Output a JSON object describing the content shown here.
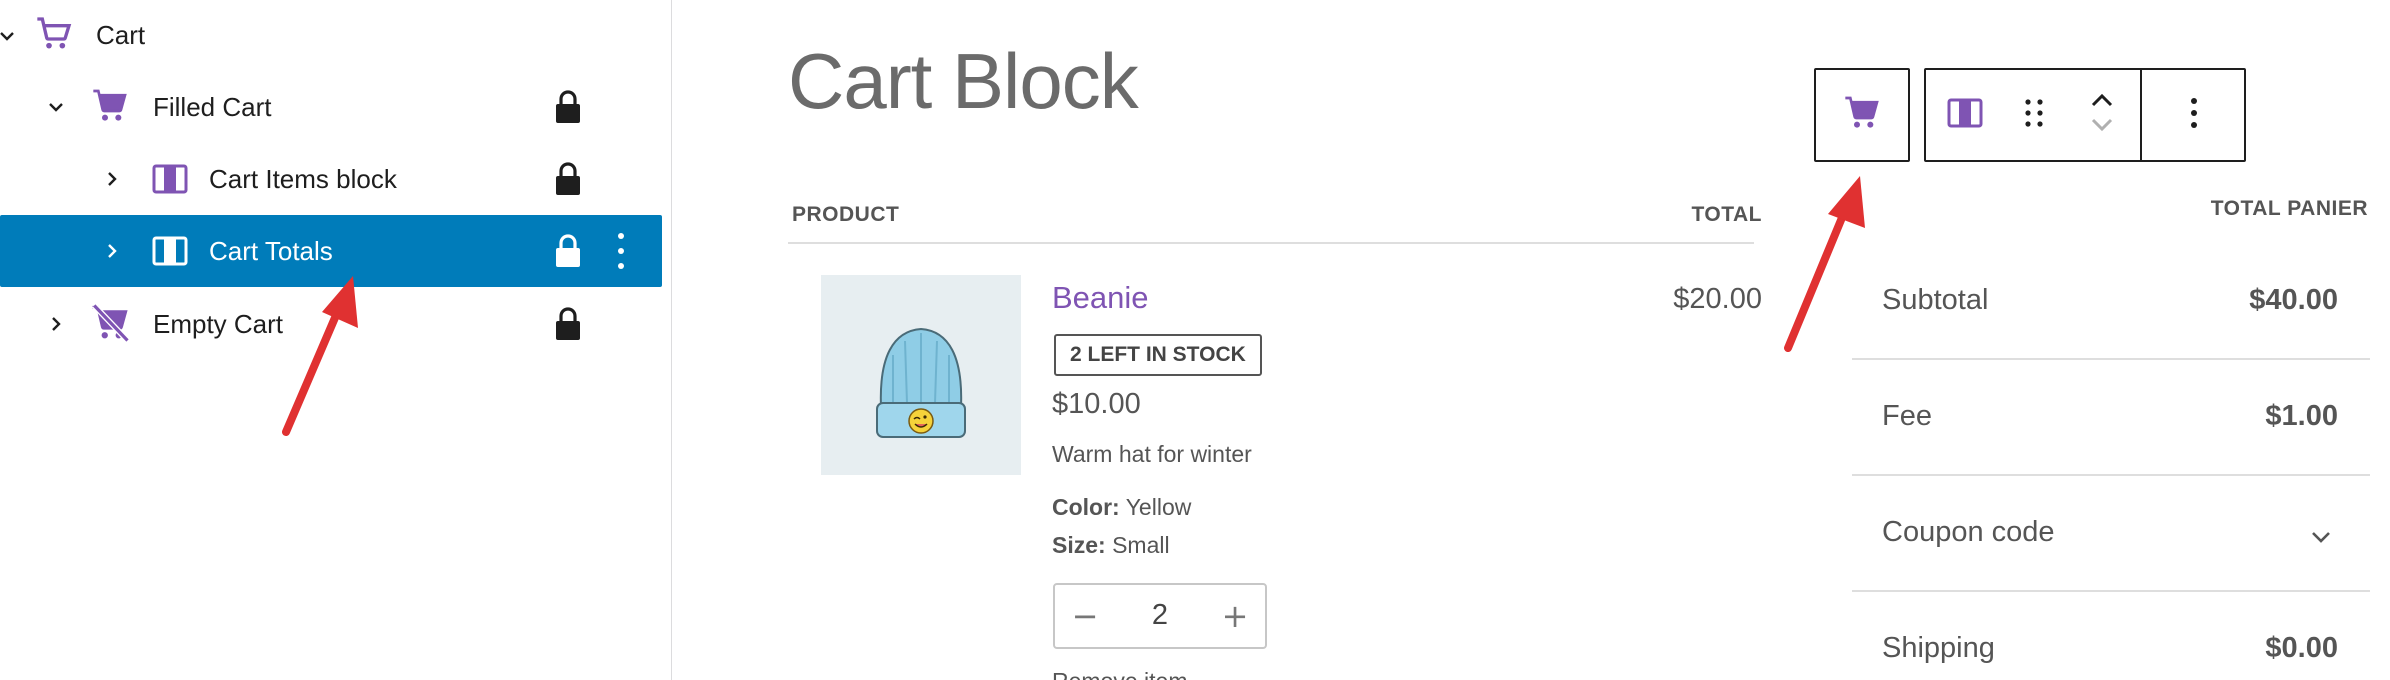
{
  "list_view": {
    "items": [
      {
        "label": "Cart"
      },
      {
        "label": "Filled Cart"
      },
      {
        "label": "Cart Items block"
      },
      {
        "label": "Cart Totals"
      },
      {
        "label": "Empty Cart"
      }
    ],
    "selected_item": "Cart Totals"
  },
  "page": {
    "title": "Cart Block"
  },
  "cart_items": {
    "col_product": "PRODUCT",
    "col_total": "TOTAL",
    "item": {
      "name": "Beanie",
      "stock_badge": "2 LEFT IN STOCK",
      "price": "$10.00",
      "description": "Warm hat for winter",
      "color_label": "Color:",
      "color_value": "Yellow",
      "size_label": "Size:",
      "size_value": "Small",
      "quantity": "2",
      "line_total": "$20.00",
      "remove_label": "Remove item"
    }
  },
  "cart_totals": {
    "heading": "TOTAL PANIER",
    "rows": [
      {
        "label": "Subtotal",
        "value": "$40.00"
      },
      {
        "label": "Fee",
        "value": "$1.00"
      },
      {
        "label": "Coupon code"
      },
      {
        "label": "Shipping",
        "value": "$0.00"
      }
    ]
  },
  "toolbar": {
    "buttons": [
      "cart-icon",
      "columns-icon",
      "drag-handle-icon",
      "move-up-icon",
      "move-down-icon",
      "more-options-icon"
    ]
  },
  "colors": {
    "accent": "#7f54b3",
    "selection": "#007cba",
    "annotation_arrow": "#e03131"
  }
}
